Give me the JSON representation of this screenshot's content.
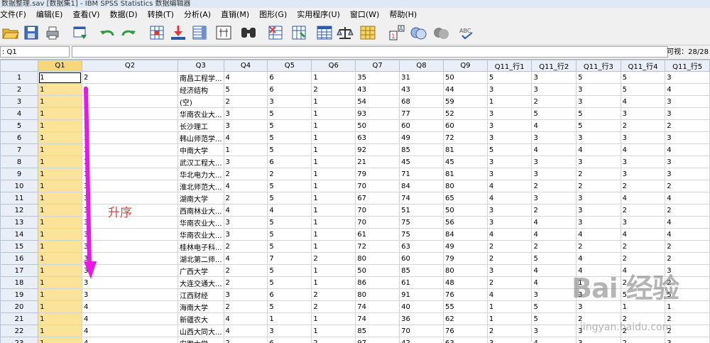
{
  "window": {
    "title": "数据整理.sav [数据集1] - IBM SPSS Statistics 数据编辑器"
  },
  "menu": [
    "文件(F)",
    "编辑(E)",
    "查看(V)",
    "数据(D)",
    "转换(T)",
    "分析(A)",
    "直销(M)",
    "图形(G)",
    "实用程序(U)",
    "窗口(W)",
    "帮助(H)"
  ],
  "toolbar": {
    "buttons": [
      "open-icon",
      "save-icon",
      "print-icon",
      "dialog-recall-icon",
      "undo-icon",
      "redo-icon",
      "goto-case-icon",
      "goto-variable-icon",
      "variables-icon",
      "run-descriptives-icon",
      "find-icon",
      "insert-cases-icon",
      "insert-variable-icon",
      "split-file-icon",
      "weight-cases-icon",
      "select-cases-icon",
      "value-labels-icon",
      "use-variable-sets-icon",
      "show-all-variables-icon",
      "spelling-icon"
    ],
    "spell_label": "ABC"
  },
  "editbar": {
    "cell_ref": ": Q1",
    "cell_value": "",
    "visible_count": "可视：28/28"
  },
  "grid": {
    "columns": [
      "Q1",
      "Q2",
      "Q3",
      "Q4",
      "Q5",
      "Q6",
      "Q7",
      "Q8",
      "Q9",
      "Q11_行1",
      "Q11_行2",
      "Q11_行3",
      "Q11_行4",
      "Q11_行5"
    ],
    "rows": [
      [
        "1",
        "1",
        "2",
        "南昌工程学...",
        "4",
        "6",
        "1",
        "35",
        "31",
        "50",
        "5",
        "3",
        "5",
        "5",
        "3"
      ],
      [
        "2",
        "1",
        "2",
        "经济结构",
        "5",
        "6",
        "2",
        "43",
        "43",
        "44",
        "3",
        "3",
        "3",
        "5",
        "4"
      ],
      [
        "3",
        "1",
        "2",
        "(空)",
        "2",
        "3",
        "1",
        "54",
        "68",
        "59",
        "1",
        "2",
        "3",
        "4",
        "3"
      ],
      [
        "4",
        "1",
        "3",
        "华南农业大...",
        "3",
        "5",
        "1",
        "93",
        "77",
        "52",
        "3",
        "5",
        "5",
        "3",
        "3"
      ],
      [
        "5",
        "1",
        "3",
        "长沙理工",
        "3",
        "5",
        "1",
        "50",
        "60",
        "60",
        "3",
        "4",
        "5",
        "2",
        "2"
      ],
      [
        "6",
        "1",
        "3",
        "韩山师范学...",
        "4",
        "5",
        "1",
        "63",
        "49",
        "72",
        "3",
        "3",
        "3",
        "3",
        "3"
      ],
      [
        "7",
        "1",
        "3",
        "中南大学",
        "1",
        "5",
        "1",
        "92",
        "85",
        "81",
        "5",
        "4",
        "4",
        "4",
        "4"
      ],
      [
        "8",
        "1",
        "3",
        "武汉工程大...",
        "3",
        "6",
        "1",
        "21",
        "45",
        "45",
        "3",
        "3",
        "3",
        "3",
        "3"
      ],
      [
        "9",
        "1",
        "3",
        "华北电力大...",
        "2",
        "2",
        "1",
        "79",
        "71",
        "81",
        "3",
        "3",
        "2",
        "3",
        "3"
      ],
      [
        "10",
        "1",
        "3",
        "淮北师范大...",
        "4",
        "5",
        "1",
        "70",
        "84",
        "80",
        "4",
        "2",
        "2",
        "2",
        "2"
      ],
      [
        "11",
        "1",
        "3",
        "湖南大学",
        "2",
        "5",
        "1",
        "67",
        "74",
        "65",
        "4",
        "3",
        "3",
        "4",
        "4"
      ],
      [
        "12",
        "1",
        "3",
        "西南林业大...",
        "4",
        "4",
        "1",
        "70",
        "51",
        "50",
        "3",
        "2",
        "3",
        "2",
        "2"
      ],
      [
        "13",
        "1",
        "3",
        "华南农业大...",
        "3",
        "5",
        "1",
        "70",
        "75",
        "56",
        "3",
        "4",
        "3",
        "3",
        "4"
      ],
      [
        "14",
        "1",
        "3",
        "华南农业大...",
        "3",
        "5",
        "1",
        "61",
        "75",
        "84",
        "4",
        "4",
        "4",
        "4",
        "4"
      ],
      [
        "15",
        "1",
        "3",
        "桂林电子科...",
        "2",
        "5",
        "1",
        "72",
        "63",
        "49",
        "2",
        "2",
        "2",
        "2",
        "2"
      ],
      [
        "16",
        "1",
        "3",
        "湖北第二师...",
        "4",
        "7",
        "2",
        "80",
        "60",
        "79",
        "2",
        "5",
        "4",
        "2",
        "2"
      ],
      [
        "17",
        "1",
        "3",
        "广西大学",
        "2",
        "5",
        "1",
        "50",
        "85",
        "80",
        "3",
        "4",
        "4",
        "4",
        "3"
      ],
      [
        "18",
        "1",
        "3",
        "大连交通大...",
        "2",
        "5",
        "1",
        "86",
        "61",
        "48",
        "2",
        "4",
        "1",
        "2",
        "2"
      ],
      [
        "19",
        "1",
        "3",
        "江西财经",
        "3",
        "6",
        "2",
        "80",
        "91",
        "76",
        "4",
        "3",
        "3",
        "5",
        "5"
      ],
      [
        "20",
        "1",
        "4",
        "海南大学",
        "2",
        "5",
        "2",
        "74",
        "40",
        "55",
        "1",
        "5",
        "3",
        "1",
        "1"
      ],
      [
        "21",
        "1",
        "4",
        "新疆农大",
        "4",
        "1",
        "1",
        "74",
        "36",
        "62",
        "1",
        "5",
        "2",
        "2",
        "2"
      ],
      [
        "22",
        "1",
        "4",
        "山西大同大...",
        "4",
        "3",
        "1",
        "85",
        "70",
        "76",
        "2",
        "3",
        "3",
        "2",
        "2"
      ],
      [
        "23",
        "1",
        "4",
        "安徽大学",
        "2",
        "6",
        "2",
        "97",
        "42",
        "63",
        "3",
        "4",
        "3",
        "2",
        "3"
      ]
    ]
  },
  "annotation": {
    "text": "升序",
    "arrow_color": "#e619e6",
    "text_color": "#d9473f"
  },
  "watermark": {
    "brand": "Bai 经验",
    "url": "jingyan.baidu.com"
  }
}
